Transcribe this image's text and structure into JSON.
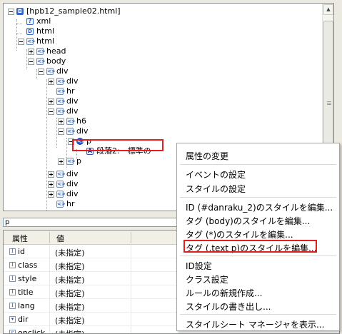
{
  "tree": {
    "nodes": [
      {
        "label": "[hpb12_sample02.html]",
        "icon": "document-icon"
      },
      {
        "label": "xml",
        "icon": "question-icon"
      },
      {
        "label": "html",
        "icon": "html-doc-icon"
      },
      {
        "label": "html",
        "icon": "tag-icon"
      },
      {
        "label": "head",
        "icon": "tag-icon"
      },
      {
        "label": "body",
        "icon": "tag-icon"
      },
      {
        "label": "div",
        "icon": "tag-icon"
      },
      {
        "label": "div",
        "icon": "tag-icon"
      },
      {
        "label": "hr",
        "icon": "tag-icon"
      },
      {
        "label": "div",
        "icon": "tag-icon"
      },
      {
        "label": "div",
        "icon": "tag-icon"
      },
      {
        "label": "h6",
        "icon": "tag-icon"
      },
      {
        "label": "div",
        "icon": "tag-icon"
      },
      {
        "label": "p",
        "icon": "tag-icon"
      },
      {
        "label": "段落2:　標準の",
        "icon": "text-icon"
      },
      {
        "label": "p",
        "icon": "tag-icon"
      },
      {
        "label": "div",
        "icon": "tag-icon"
      },
      {
        "label": "div",
        "icon": "tag-icon"
      },
      {
        "label": "div",
        "icon": "tag-icon"
      },
      {
        "label": "hr",
        "icon": "tag-icon"
      }
    ]
  },
  "search": {
    "value": "p"
  },
  "properties": {
    "header_name": "属性",
    "header_value": "値",
    "rows": [
      {
        "name": "id",
        "value": "(未指定)"
      },
      {
        "name": "class",
        "value": "(未指定)"
      },
      {
        "name": "style",
        "value": "(未指定)"
      },
      {
        "name": "title",
        "value": "(未指定)"
      },
      {
        "name": "lang",
        "value": "(未指定)"
      },
      {
        "name": "dir",
        "value": "(未指定)"
      },
      {
        "name": "onclick",
        "value": "(未指定)"
      }
    ]
  },
  "context_menu": {
    "items": [
      "属性の変更",
      "イベントの設定",
      "スタイルの設定",
      "ID (#danraku_2)のスタイルを編集...",
      "タグ (body)のスタイルを編集...",
      "タグ (*)のスタイルを編集...",
      "タグ (.text p)のスタイルを編集...",
      "ID設定",
      "クラス設定",
      "ルールの新規作成...",
      "スタイルの書き出し...",
      "スタイルシート マネージャを表示..."
    ],
    "highlighted_index": 6
  },
  "colors": {
    "highlight": "#e02020",
    "selection": "#2b5fd8"
  }
}
